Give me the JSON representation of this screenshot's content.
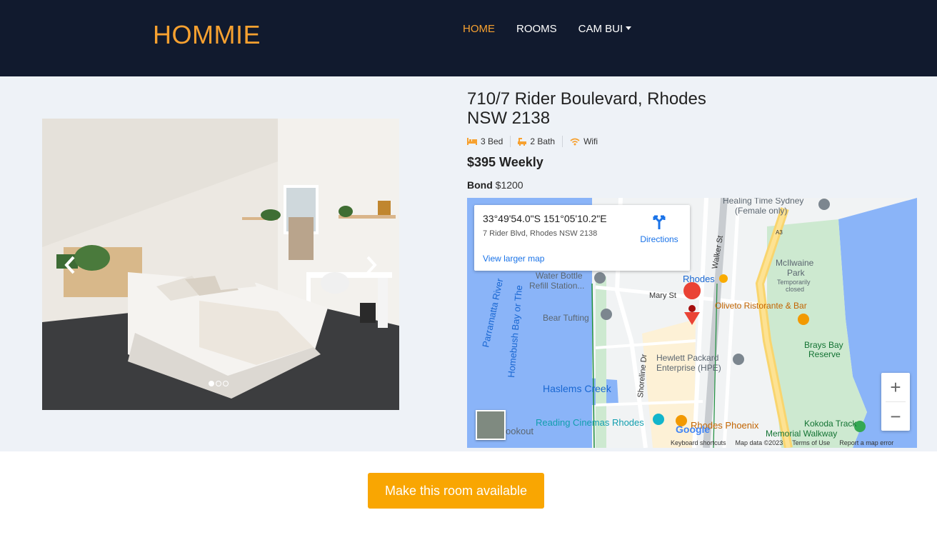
{
  "brand": "HOMMIE",
  "nav": {
    "home": "HOME",
    "rooms": "ROOMS",
    "user": "CAM BUI"
  },
  "listing": {
    "address_line1": "710/7 Rider Boulevard, Rhodes",
    "address_line2": "NSW 2138",
    "features": {
      "bed": "3 Bed",
      "bath": "2 Bath",
      "wifi": "Wifi"
    },
    "price": "$395 Weekly",
    "bond_label": "Bond",
    "bond_value": "$1200"
  },
  "carousel": {
    "slides": 3,
    "active": 0
  },
  "map": {
    "coords": "33°49'54.0\"S 151°05'10.2\"E",
    "address": "7 Rider Blvd, Rhodes NSW 2138",
    "directions": "Directions",
    "larger_map": "View larger map",
    "zoom_in": "+",
    "zoom_out": "−",
    "google": "Google",
    "attribution": [
      "Keyboard shortcuts",
      "Map data ©2023",
      "Terms of Use",
      "Report a map error"
    ],
    "labels": {
      "healing": "Healing Time Sydney",
      "female": "(Female only)",
      "walker": "Walker St",
      "water1": "Water Bottle",
      "water2": "Refill Station...",
      "rhodes": "Rhodes",
      "mcilwaine1": "McIlwaine",
      "mcilwaine2": "Park",
      "temp1": "Temporarily",
      "temp2": "closed",
      "mary": "Mary St",
      "parramatta": "Parramatta River",
      "homebush": "Homebush Bay or The",
      "bear": "Bear Tufting",
      "oliveto": "Oliveto Ristorante & Bar",
      "brays1": "Brays Bay",
      "brays2": "Reserve",
      "hp1": "Hewlett Packard",
      "hp2": "Enterprise (HPE)",
      "shoreline": "Shoreline Dr",
      "haslems": "Haslems Creek",
      "reading": "Reading Cinemas Rhodes",
      "phoenix": "Rhodes Phoenix",
      "kokoda1": "Kokoda Track",
      "kokoda2": "Memorial Walkway",
      "lookout": "ookout",
      "a3": "A3"
    }
  },
  "cta": "Make this room available",
  "colors": {
    "accent": "#f7a130",
    "navbar": "#111a2e",
    "button": "#f9a602",
    "link": "#1a73e8",
    "water": "#8ab4f8"
  }
}
